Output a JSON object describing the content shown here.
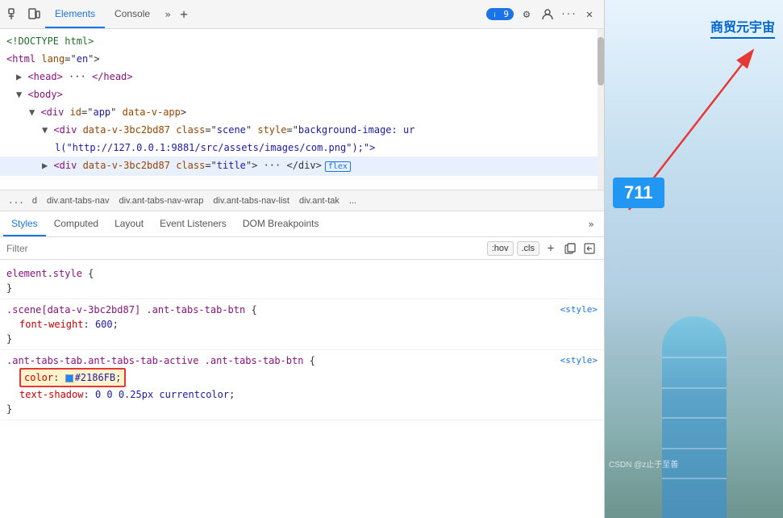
{
  "toolbar": {
    "inspect_label": "Inspect",
    "device_label": "Device",
    "tabs": [
      {
        "id": "elements",
        "label": "Elements",
        "active": true
      },
      {
        "id": "console",
        "label": "Console",
        "active": false
      }
    ],
    "more_tabs_icon": "»",
    "add_tab_icon": "+",
    "issue_count": "9",
    "settings_icon": "⚙",
    "profile_icon": "👤",
    "more_icon": "···",
    "close_icon": "✕"
  },
  "html_tree": {
    "lines": [
      {
        "indent": 0,
        "content": "<!DOCTYPE html>"
      },
      {
        "indent": 0,
        "content": "<html lang=\"en\">"
      },
      {
        "indent": 1,
        "content": "▶ <head> ··· </head>"
      },
      {
        "indent": 1,
        "content": "▼ <body>"
      },
      {
        "indent": 2,
        "content": "▼ <div id=\"app\" data-v-app>"
      },
      {
        "indent": 3,
        "content": "▼ <div data-v-3bc2bd87 class=\"scene\" style=\"background-image: ur"
      },
      {
        "indent": 4,
        "content": "l(\"http://127.0.0.1:9881/src/assets/images/com.png\");\">"
      },
      {
        "indent": 3,
        "selected": true,
        "content": "▶ <div data-v-3bc2bd87 class=\"title\"> ··· </div>",
        "badge": "flex"
      }
    ]
  },
  "breadcrumb": {
    "items": [
      "...",
      "d",
      "div.ant-tabs-nav",
      "div.ant-tabs-nav-wrap",
      "div.ant-tabs-nav-list",
      "div.ant-tak",
      "..."
    ]
  },
  "styles_tabs": [
    {
      "id": "styles",
      "label": "Styles",
      "active": true
    },
    {
      "id": "computed",
      "label": "Computed",
      "active": false
    },
    {
      "id": "layout",
      "label": "Layout",
      "active": false
    },
    {
      "id": "event_listeners",
      "label": "Event Listeners",
      "active": false
    },
    {
      "id": "dom_breakpoints",
      "label": "DOM Breakpoints",
      "active": false
    }
  ],
  "filter": {
    "placeholder": "Filter",
    "hov_label": ":hov",
    "cls_label": ".cls",
    "plus_icon": "+",
    "copy_icon": "⊞",
    "back_icon": "⊟"
  },
  "css_rules": [
    {
      "selector": "element.style {",
      "source": "",
      "properties": [],
      "close": "}"
    },
    {
      "selector": ".scene[data-v-3bc2bd87] .ant-tabs-tab-btn {",
      "source": "<style>",
      "properties": [
        {
          "name": "font-weight",
          "value": "600",
          "highlighted": false
        }
      ],
      "close": "}"
    },
    {
      "selector": ".ant-tabs-tab.ant-tabs-tab-active .ant-tabs-tab-btn {",
      "source": "<style>",
      "properties": [
        {
          "name": "color",
          "value": "#2186FB",
          "highlighted": true,
          "has_swatch": true,
          "swatch_color": "#2186fb"
        },
        {
          "name": "text-shadow",
          "value": "0 0 0.25px currentcolor",
          "highlighted": false
        }
      ],
      "close": "}"
    }
  ],
  "website": {
    "title_cn": "商贸元宇宙",
    "number": "711",
    "csdn_watermark": "CSDN @z止于至善"
  }
}
